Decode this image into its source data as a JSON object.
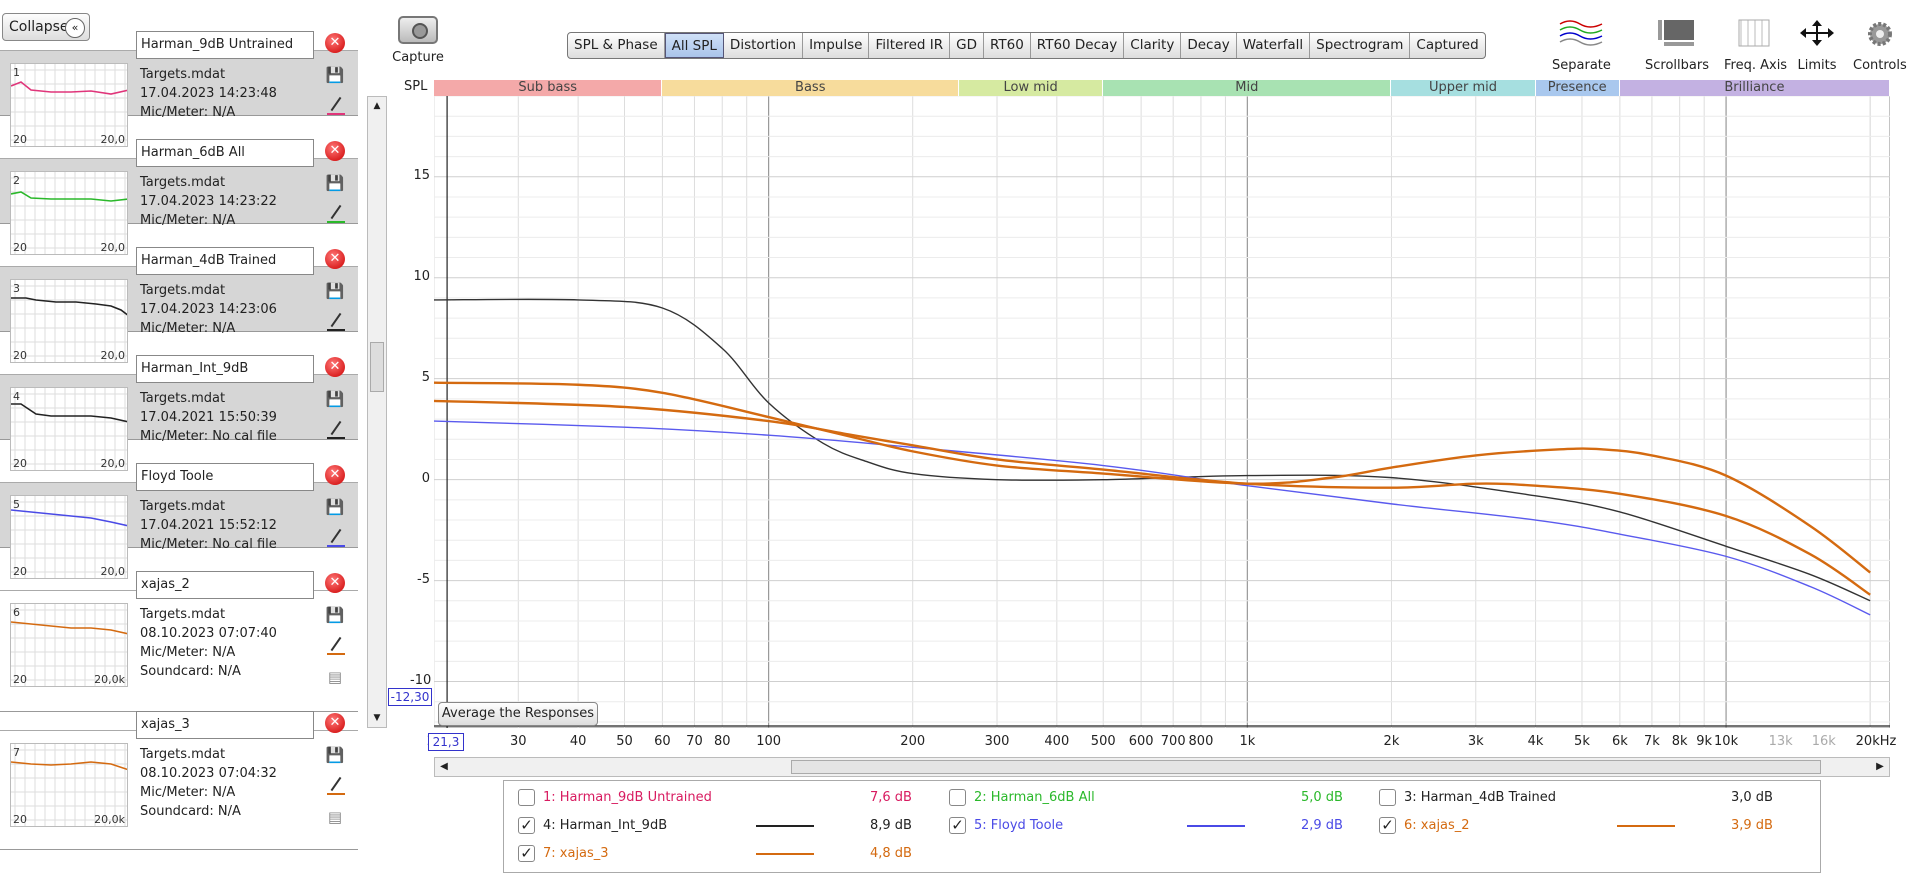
{
  "sidebar": {
    "collapse_label": "Collapse",
    "collapse_icon": "«",
    "measurements": [
      {
        "num": "1",
        "name": "Harman_9dB Untrained",
        "file": "Targets.mdat",
        "date": "17.04.2023 14:23:48",
        "mic": "Mic/Meter: N/A",
        "soundcard": "",
        "color": "#e0357a",
        "x_min": "20",
        "x_max": "20,0",
        "selected": false
      },
      {
        "num": "2",
        "name": "Harman_6dB All",
        "file": "Targets.mdat",
        "date": "17.04.2023 14:23:22",
        "mic": "Mic/Meter: N/A",
        "soundcard": "",
        "color": "#2ab82a",
        "x_min": "20",
        "x_max": "20,0",
        "selected": false
      },
      {
        "num": "3",
        "name": "Harman_4dB Trained",
        "file": "Targets.mdat",
        "date": "17.04.2023 14:23:06",
        "mic": "Mic/Meter: N/A",
        "soundcard": "",
        "color": "#222222",
        "x_min": "20",
        "x_max": "20,0",
        "selected": false
      },
      {
        "num": "4",
        "name": "Harman_Int_9dB",
        "file": "Targets.mdat",
        "date": "17.04.2021 15:50:39",
        "mic": "Mic/Meter: No cal file",
        "soundcard": "",
        "color": "#222222",
        "x_min": "20",
        "x_max": "20,0",
        "selected": false
      },
      {
        "num": "5",
        "name": "Floyd Toole",
        "file": "Targets.mdat",
        "date": "17.04.2021 15:52:12",
        "mic": "Mic/Meter: No cal file",
        "soundcard": "",
        "color": "#4a4ae6",
        "x_min": "20",
        "x_max": "20,0",
        "selected": false
      },
      {
        "num": "6",
        "name": "xajas_2",
        "file": "Targets.mdat",
        "date": "08.10.2023 07:07:40",
        "mic": "Mic/Meter: N/A",
        "soundcard": "Soundcard: N/A",
        "color": "#d46a10",
        "x_min": "20",
        "x_max": "20,0k",
        "selected": true
      },
      {
        "num": "7",
        "name": "xajas_3",
        "file": "Targets.mdat",
        "date": "08.10.2023 07:04:32",
        "mic": "Mic/Meter: N/A",
        "soundcard": "Soundcard: N/A",
        "color": "#d46a10",
        "x_min": "20",
        "x_max": "20,0k",
        "selected": true
      }
    ]
  },
  "toolbar": {
    "capture_label": "Capture",
    "tabs": [
      "SPL & Phase",
      "All SPL",
      "Distortion",
      "Impulse",
      "Filtered IR",
      "GD",
      "RT60",
      "RT60 Decay",
      "Clarity",
      "Decay",
      "Waterfall",
      "Spectrogram",
      "Captured"
    ],
    "active_tab": "All SPL",
    "tools": [
      "Separate",
      "Scrollbars",
      "Freq. Axis",
      "Limits",
      "Controls"
    ]
  },
  "graph": {
    "y_axis_label": "SPL",
    "bands": [
      {
        "label": "Sub bass",
        "color": "#f4a9a9"
      },
      {
        "label": "Bass",
        "color": "#f7dc9c"
      },
      {
        "label": "Low mid",
        "color": "#d6eaa1"
      },
      {
        "label": "Mid",
        "color": "#a8e2b2"
      },
      {
        "label": "Upper mid",
        "color": "#a6dfe0"
      },
      {
        "label": "Presence",
        "color": "#a9c8ee"
      },
      {
        "label": "Brilliance",
        "color": "#c3b1e2"
      }
    ],
    "y_ticks": [
      "15",
      "10",
      "5",
      "0",
      "-5",
      "-10"
    ],
    "x_ticks": [
      "30",
      "40",
      "50",
      "60",
      "70",
      "80",
      "100",
      "200",
      "300",
      "400",
      "500",
      "600",
      "700",
      "800",
      "1k",
      "2k",
      "3k",
      "4k",
      "5k",
      "6k",
      "7k",
      "8k",
      "9k",
      "10k",
      "13k",
      "16k",
      "20kHz"
    ],
    "x_tick_first": "2",
    "cursor_x": "21,3",
    "cursor_y": "-12,30",
    "average_button": "Average the Responses"
  },
  "chart_data": {
    "type": "line",
    "x_scale": "log",
    "xlim": [
      20,
      22000
    ],
    "ylim": [
      -12.3,
      19
    ],
    "series": [
      {
        "name": "4: Harman_Int_9dB",
        "color": "#333333",
        "x": [
          20,
          40,
          60,
          80,
          100,
          130,
          160,
          200,
          300,
          500,
          1000,
          2000,
          4000,
          6000,
          10000,
          15000,
          20000
        ],
        "values": [
          8.9,
          8.9,
          8.5,
          6.5,
          3.8,
          1.8,
          0.9,
          0.3,
          0.0,
          0.0,
          0.2,
          0.1,
          -0.8,
          -1.6,
          -3.3,
          -4.7,
          -6.0
        ]
      },
      {
        "name": "5: Floyd Toole",
        "color": "#5a5aee",
        "x": [
          20,
          50,
          100,
          200,
          500,
          1000,
          2000,
          4000,
          6000,
          10000,
          15000,
          20000
        ],
        "values": [
          2.9,
          2.6,
          2.2,
          1.6,
          0.7,
          -0.3,
          -1.2,
          -2.0,
          -2.7,
          -3.8,
          -5.3,
          -6.7
        ]
      },
      {
        "name": "6: xajas_2",
        "color": "#d46a10",
        "x": [
          20,
          50,
          100,
          150,
          200,
          300,
          500,
          1000,
          2000,
          3000,
          4000,
          6000,
          10000,
          15000,
          20000
        ],
        "values": [
          3.9,
          3.6,
          2.9,
          2.2,
          1.7,
          1.0,
          0.5,
          -0.2,
          -0.4,
          -0.2,
          -0.3,
          -0.7,
          -1.8,
          -3.7,
          -5.7
        ]
      },
      {
        "name": "7: xajas_3",
        "color": "#d46a10",
        "x": [
          20,
          40,
          60,
          100,
          150,
          200,
          300,
          500,
          1000,
          1500,
          2000,
          3000,
          4500,
          5500,
          7000,
          10000,
          15000,
          20000
        ],
        "values": [
          4.8,
          4.7,
          4.3,
          3.1,
          2.1,
          1.4,
          0.7,
          0.3,
          -0.2,
          0.1,
          0.6,
          1.2,
          1.5,
          1.5,
          1.2,
          0.2,
          -2.3,
          -4.6
        ]
      }
    ]
  },
  "legend": {
    "items": [
      {
        "label": "1: Harman_9dB Untrained",
        "value": "7,6 dB",
        "checked": false,
        "color": "#d81b60",
        "line": false
      },
      {
        "label": "2: Harman_6dB All",
        "value": "5,0 dB",
        "checked": false,
        "color": "#2ab82a",
        "line": false
      },
      {
        "label": "3: Harman_4dB Trained",
        "value": "3,0 dB",
        "checked": false,
        "color": "#222222",
        "line": false
      },
      {
        "label": "4: Harman_Int_9dB",
        "value": "8,9 dB",
        "checked": true,
        "color": "#222222",
        "line": true
      },
      {
        "label": "5: Floyd Toole",
        "value": "2,9 dB",
        "checked": true,
        "color": "#4a4ae6",
        "line": true
      },
      {
        "label": "6: xajas_2",
        "value": "3,9 dB",
        "checked": true,
        "color": "#d46a10",
        "line": true
      },
      {
        "label": "7: xajas_3",
        "value": "4,8 dB",
        "checked": true,
        "color": "#d46a10",
        "line": true
      }
    ]
  }
}
